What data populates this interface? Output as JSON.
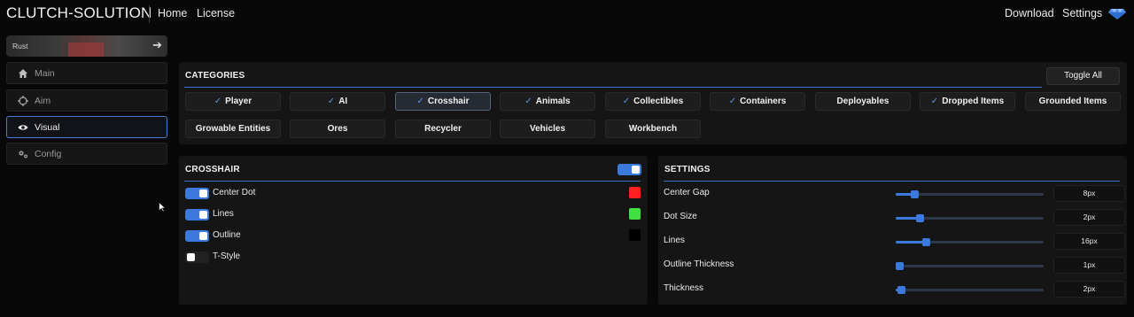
{
  "header": {
    "brand": "CLUTCH-SOLUTION",
    "nav": [
      "Home",
      "License"
    ],
    "right_nav": [
      "Download",
      "Settings"
    ],
    "gem_icon": "diamond-icon",
    "accent": "#3b79dd"
  },
  "sidebar": {
    "game": {
      "label": "Rust",
      "arrow_icon": "arrow-right-icon"
    },
    "items": [
      {
        "label": "Main",
        "icon": "home-icon",
        "active": false
      },
      {
        "label": "Aim",
        "icon": "crosshair-icon",
        "active": false
      },
      {
        "label": "Visual",
        "icon": "eye-icon",
        "active": true
      },
      {
        "label": "Config",
        "icon": "gears-icon",
        "active": false
      }
    ]
  },
  "categories": {
    "title": "CATEGORIES",
    "toggle_all": "Toggle All",
    "items": [
      {
        "label": "Player",
        "checked": true,
        "selected": false
      },
      {
        "label": "AI",
        "checked": true,
        "selected": false
      },
      {
        "label": "Crosshair",
        "checked": true,
        "selected": true
      },
      {
        "label": "Animals",
        "checked": true,
        "selected": false
      },
      {
        "label": "Collectibles",
        "checked": true,
        "selected": false
      },
      {
        "label": "Containers",
        "checked": true,
        "selected": false
      },
      {
        "label": "Deployables",
        "checked": false,
        "selected": false
      },
      {
        "label": "Dropped Items",
        "checked": true,
        "selected": false
      },
      {
        "label": "Grounded Items",
        "checked": false,
        "selected": false
      },
      {
        "label": "Growable Entities",
        "checked": false,
        "selected": false
      },
      {
        "label": "Ores",
        "checked": false,
        "selected": false
      },
      {
        "label": "Recycler",
        "checked": false,
        "selected": false
      },
      {
        "label": "Vehicles",
        "checked": false,
        "selected": false
      },
      {
        "label": "Workbench",
        "checked": false,
        "selected": false
      }
    ]
  },
  "crosshair": {
    "title": "CROSSHAIR",
    "enabled": true,
    "options": [
      {
        "label": "Center Dot",
        "on": true,
        "color": "#ff2020"
      },
      {
        "label": "Lines",
        "on": true,
        "color": "#3fe040"
      },
      {
        "label": "Outline",
        "on": true,
        "color": "#000000"
      },
      {
        "label": "T-Style",
        "on": false,
        "color": null
      }
    ]
  },
  "settings": {
    "title": "SETTINGS",
    "sliders": [
      {
        "label": "Center Gap",
        "value": "8px",
        "level": 0.1
      },
      {
        "label": "Dot Size",
        "value": "2px",
        "level": 0.14
      },
      {
        "label": "Lines",
        "value": "16px",
        "level": 0.18
      },
      {
        "label": "Outline Thickness",
        "value": "1px",
        "level": 0.0
      },
      {
        "label": "Thickness",
        "value": "2px",
        "level": 0.01
      }
    ]
  }
}
